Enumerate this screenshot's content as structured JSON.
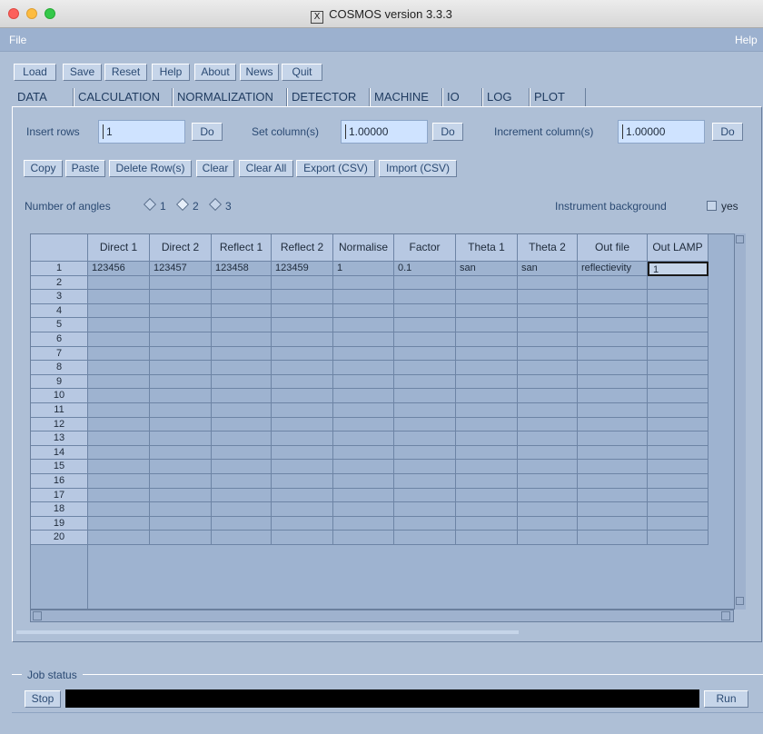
{
  "window": {
    "title": "COSMOS version 3.3.3"
  },
  "menubar": {
    "file": "File",
    "help": "Help"
  },
  "toolbar": [
    "Load",
    "Save",
    "Reset",
    "Help",
    "About",
    "News",
    "Quit"
  ],
  "tabs": [
    "DATA",
    "CALCULATION",
    "NORMALIZATION",
    "DETECTOR",
    "MACHINE",
    "IO",
    "LOG",
    "PLOT"
  ],
  "controls": {
    "insert_rows_label": "Insert rows",
    "insert_rows_value": "1",
    "set_columns_label": "Set column(s)",
    "set_columns_value": "1.00000",
    "increment_columns_label": "Increment column(s)",
    "increment_columns_value": "1.00000",
    "do_label": "Do"
  },
  "edit_buttons": [
    "Copy",
    "Paste",
    "Delete Row(s)",
    "Clear",
    "Clear All",
    "Export (CSV)",
    "Import (CSV)"
  ],
  "angles": {
    "label": "Number of angles",
    "options": [
      "1",
      "2",
      "3"
    ]
  },
  "background": {
    "label": "Instrument background",
    "checkbox_label": "yes"
  },
  "table": {
    "columns": [
      "Direct 1",
      "Direct 2",
      "Reflect 1",
      "Reflect 2",
      "Normalise",
      "Factor",
      "Theta 1",
      "Theta 2",
      "Out file",
      "Out LAMP"
    ],
    "row_count": 20,
    "row1": [
      "123456",
      "123457",
      "123458",
      "123459",
      "1",
      "0.1",
      "san",
      "san",
      "reflectievity",
      "1"
    ]
  },
  "job_status": {
    "label": "Job status",
    "stop": "Stop",
    "run": "Run"
  },
  "colors": {
    "background": "#aebfd6",
    "input": "#cfe3ff",
    "text": "#1e3a5f"
  }
}
